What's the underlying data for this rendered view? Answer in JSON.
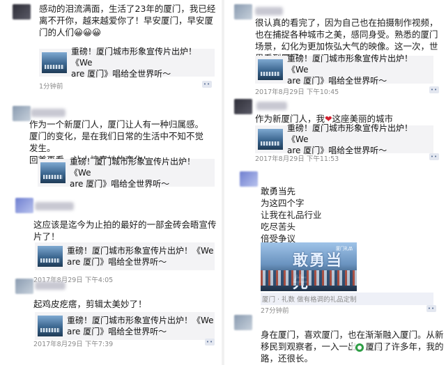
{
  "left": {
    "posts": [
      {
        "text": "感动的泪流满面，生活了23年的厦门，我已经\n离不开你，越来越爱你了！早安厦门，早安厦\n门的人们😀😀😀",
        "card_title": "重磅！厦门城市形象宣传片出炉！《We\nare 厦门》唱给全世界听～",
        "time": "1分钟前"
      },
      {
        "text": "作为一个新厦门人，厦门让人有一种归属感。\n厦门的变化，是在我们日常的生活中不知不觉\n发生。\n回首再看，让人惊喜她的变化！",
        "card_title": "重磅！厦门城市形象宣传片出炉！《We\nare 厦门》唱给全世界听～",
        "time": ""
      },
      {
        "text": "这应该是迄今为止拍的最好的一部金砖会晤宣传\n片了！",
        "card_title": "重磅！厦门城市形象宣传片出炉！《We\nare 厦门》唱给全世界听～",
        "time": "2017年8月29日  下午4:05"
      },
      {
        "text": "起鸡皮疙瘩，剪辑太美妙了！",
        "card_title": "重磅！厦门城市形象宣传片出炉！《We\nare 厦门》唱给全世界听～",
        "time": "2017年8月29日  下午7:39"
      }
    ]
  },
  "right": {
    "posts": [
      {
        "text": "很认真的看完了，因为自己也在拍摄制作视频，\n也在捕捉各种城市之美，感同身受。熟悉的厦门\n场景，幻化为更加恢弘大气的映像。这一次，世\n界看到厦门！",
        "card_title": "重磅！厦门城市形象宣传片出炉！《We\nare 厦门》唱给全世界听～",
        "time": "2017年8月29日  下午10:45"
      },
      {
        "text_before": "作为新厦门人，我",
        "heart": "❤",
        "text_after": "这座美丽的城市",
        "card_title": "重磅！厦门城市形象宣传片出炉！《We\nare 厦门》唱给全世界听～",
        "time": "2017年8月29日  下午11:53"
      },
      {
        "text": "敢勇当先\n为这四个字\n让我在礼品行业\n吃尽苦头\n倍受争议",
        "image_slogan": "敢勇当先",
        "image_tag": "厦门礼品",
        "caption": "厦门 · 礼数  做有格调的礼品定制",
        "time": "27分钟前"
      },
      {
        "text": "身在厦门，喜欢厦门，也在渐渐融入厦门。从新\n移民到观察者，一入一出，跨越了许多年，我的\n路，还很长。"
      }
    ]
  },
  "more_label": "••",
  "watermark": "厦门"
}
